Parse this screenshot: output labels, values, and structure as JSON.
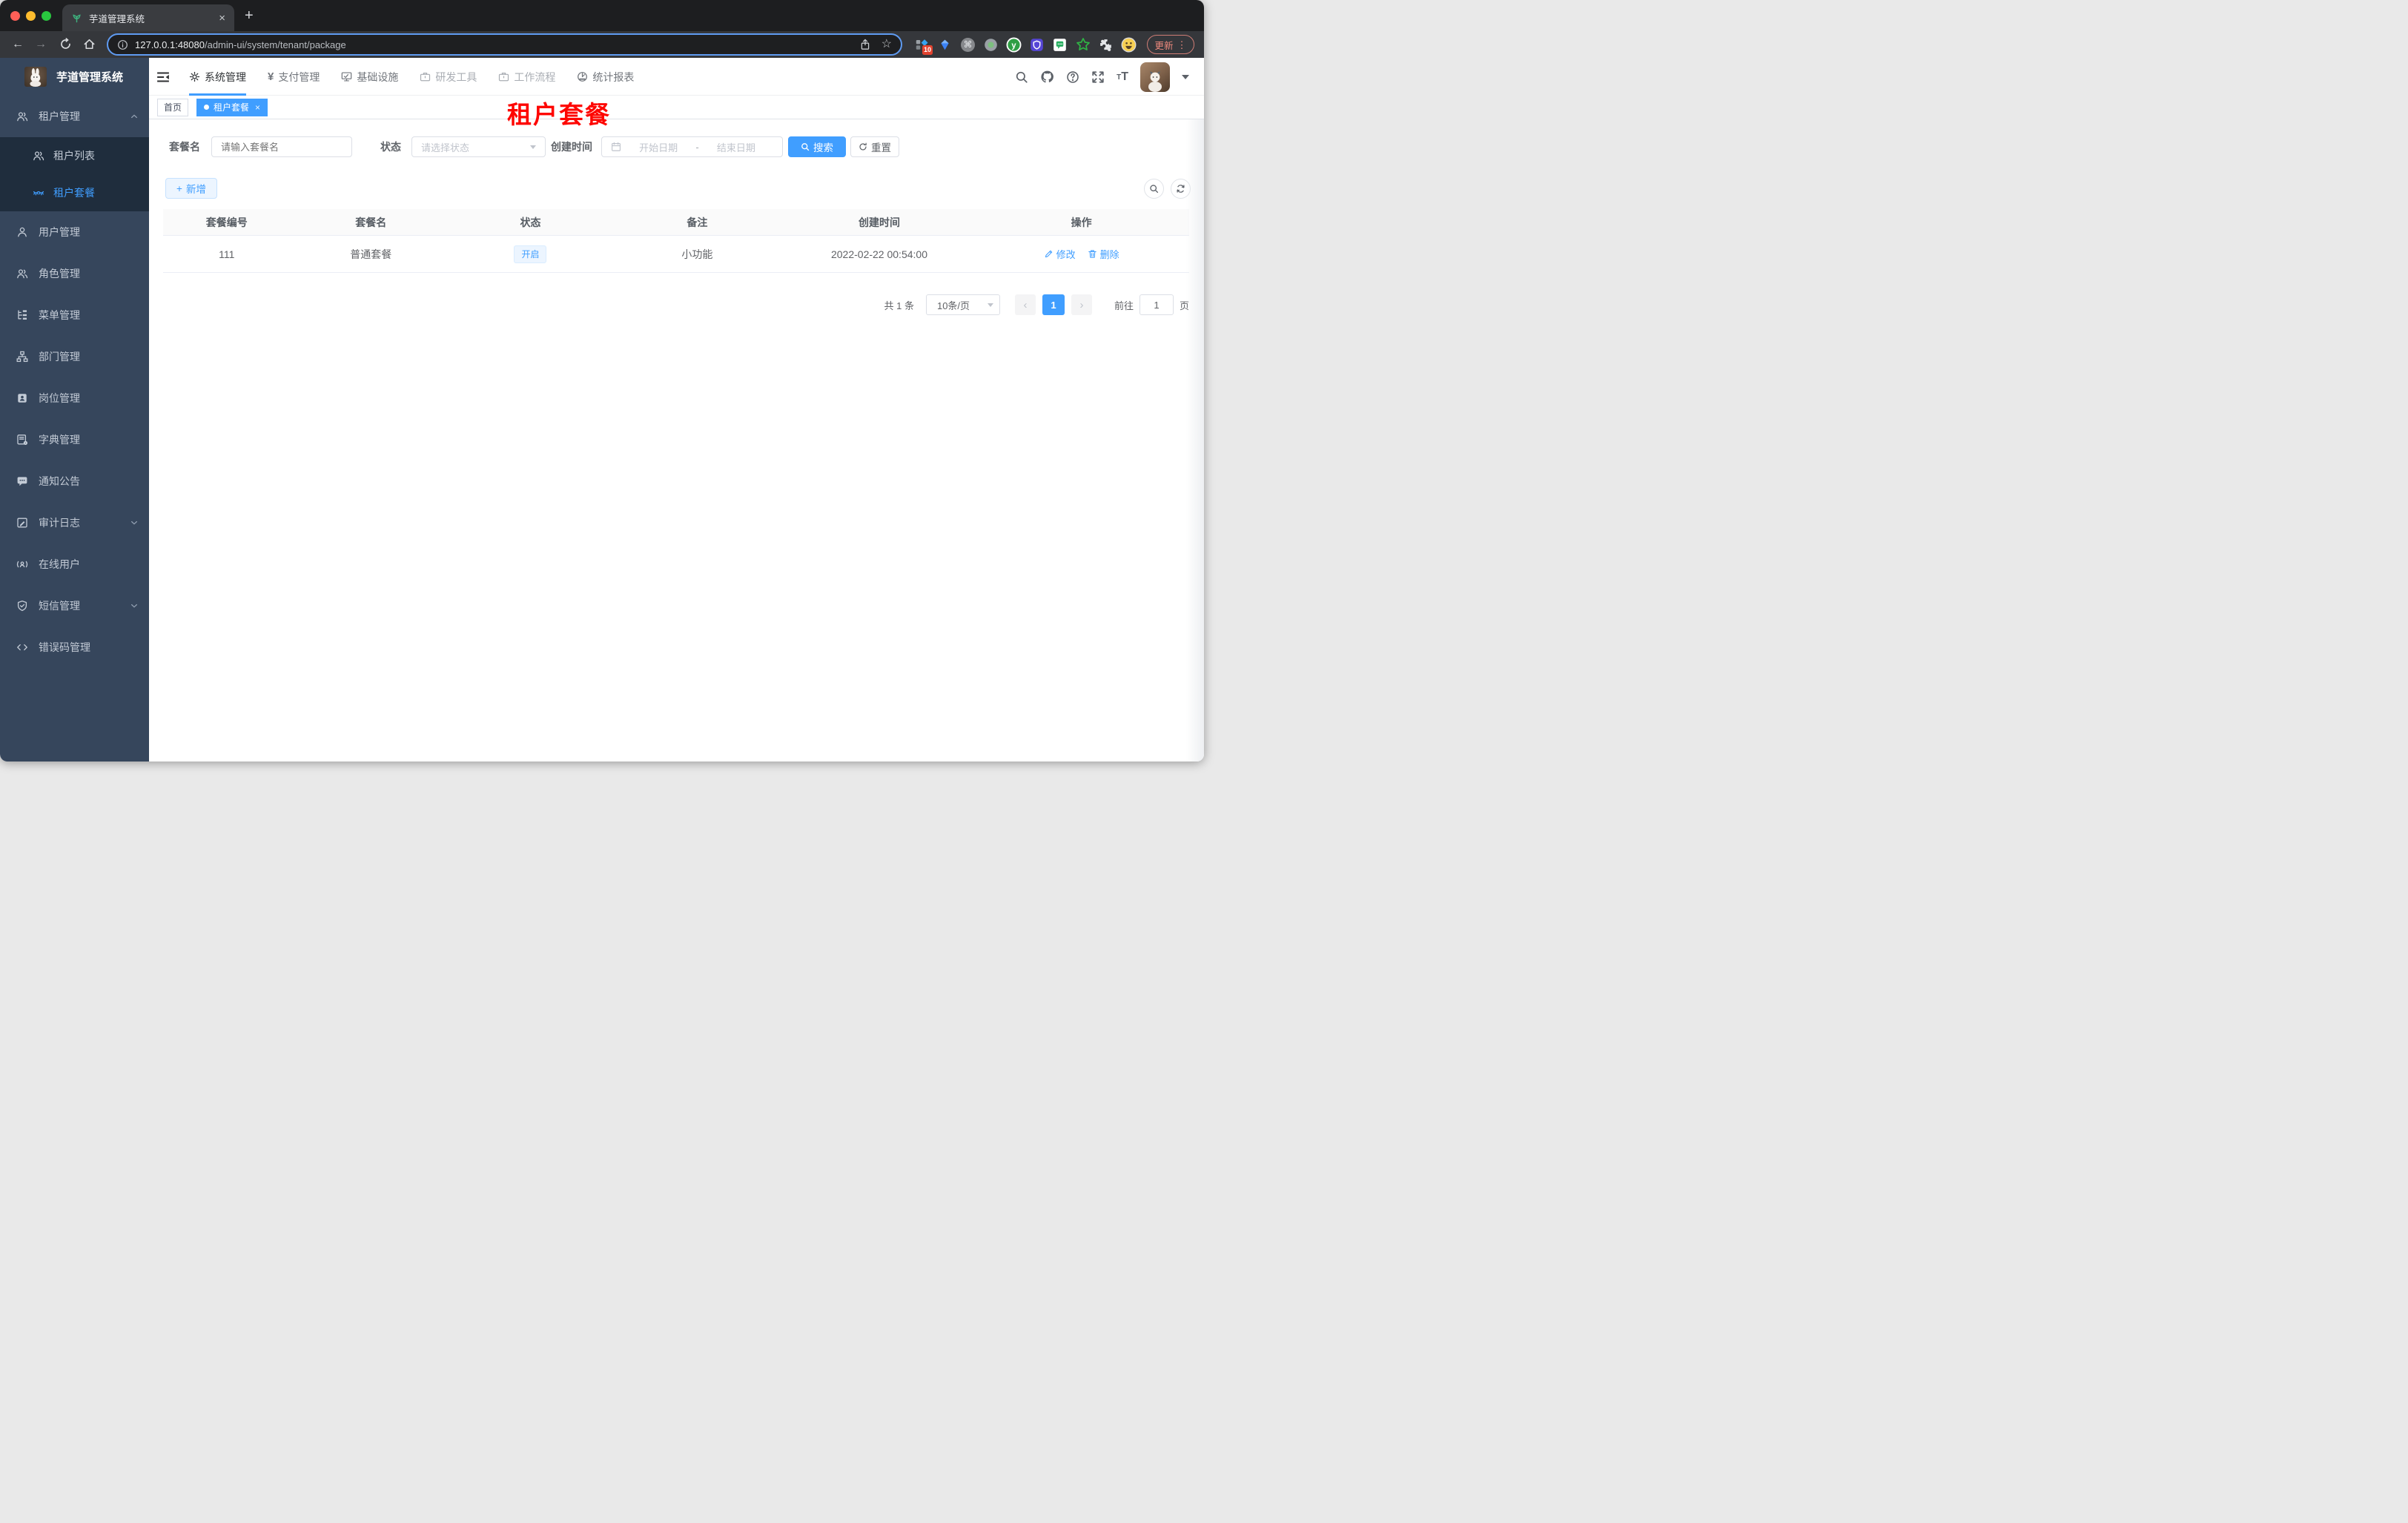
{
  "browser": {
    "tab_title": "芋道管理系统",
    "url_host": "127.0.0.1:48080",
    "url_path": "/admin-ui/system/tenant/package",
    "update_label": "更新",
    "extension_badge": "10"
  },
  "icons": {
    "close": "×",
    "plus": "+",
    "kebab": "⋮",
    "back": "←",
    "forward": "→",
    "star": "☆",
    "command": "⌘",
    "yen": "¥",
    "font_glyph": "T",
    "prev": "‹",
    "next": "›",
    "ext_letter": "y"
  },
  "nav": {
    "items": [
      {
        "label": "系统管理"
      },
      {
        "label": "支付管理"
      },
      {
        "label": "基础设施"
      },
      {
        "label": "研发工具"
      },
      {
        "label": "工作流程"
      },
      {
        "label": "统计报表"
      }
    ]
  },
  "sidebar": {
    "title": "芋道管理系统",
    "items": [
      {
        "label": "租户管理"
      },
      {
        "label": "租户列表"
      },
      {
        "label": "租户套餐"
      },
      {
        "label": "用户管理"
      },
      {
        "label": "角色管理"
      },
      {
        "label": "菜单管理"
      },
      {
        "label": "部门管理"
      },
      {
        "label": "岗位管理"
      },
      {
        "label": "字典管理"
      },
      {
        "label": "通知公告"
      },
      {
        "label": "审计日志"
      },
      {
        "label": "在线用户"
      },
      {
        "label": "短信管理"
      },
      {
        "label": "错误码管理"
      }
    ]
  },
  "tags": {
    "home": "首页",
    "active": "租户套餐"
  },
  "annotation": "租户套餐",
  "filters": {
    "name_label": "套餐名",
    "name_placeholder": "请输入套餐名",
    "status_label": "状态",
    "status_placeholder": "请选择状态",
    "date_label": "创建时间",
    "date_start": "开始日期",
    "date_separator": "-",
    "date_end": "结束日期",
    "search_label": "搜索",
    "reset_label": "重置"
  },
  "toolbar": {
    "add_label": "新增"
  },
  "table": {
    "columns": [
      "套餐编号",
      "套餐名",
      "状态",
      "备注",
      "创建时间",
      "操作"
    ],
    "rows": [
      {
        "id": "111",
        "name": "普通套餐",
        "status": "开启",
        "remark": "小功能",
        "created_at": "2022-02-22 00:54:00",
        "edit_label": "修改",
        "delete_label": "删除"
      }
    ]
  },
  "pagination": {
    "total": "共 1 条",
    "page_size": "10条/页",
    "current_page": "1",
    "goto_label": "前往",
    "goto_value": "1",
    "unit_label": "页"
  },
  "colors": {
    "accent": "#409eff",
    "sidebar_bg": "#36465c",
    "submenu_bg": "#1f2d3d",
    "annotation_red": "#fe0500"
  }
}
